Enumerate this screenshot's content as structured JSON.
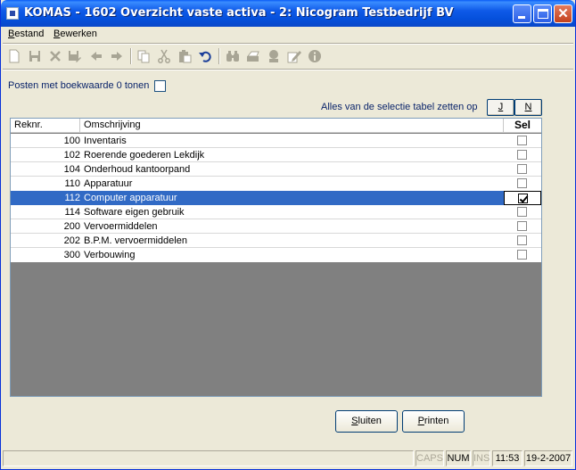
{
  "window": {
    "title": "KOMAS - 1602 Overzicht vaste activa - 2: Nicogram Testbedrijf BV",
    "controls": {
      "close_glyph": "✕"
    }
  },
  "menu": {
    "items": [
      {
        "label_prefix": "B",
        "label_rest": "estand"
      },
      {
        "label_prefix": "",
        "label_underline": "B",
        "label_rest": "ewerken",
        "full": "Bewerken"
      }
    ]
  },
  "toolbar": {
    "icons": [
      "new-icon",
      "save-icon",
      "delete-icon",
      "save-as-icon",
      "back-arrow-icon",
      "forward-arrow-icon",
      "copy-icon",
      "cut-icon",
      "paste-icon",
      "undo-icon",
      "binoculars-icon",
      "print-icon",
      "stamp-icon",
      "edit-icon",
      "info-icon"
    ]
  },
  "filters": {
    "zero_value_label": "Posten met boekwaarde 0 tonen",
    "zero_value_checked": false,
    "select_all_label": "Alles van de selectie tabel zetten op",
    "btn_yes": "J",
    "btn_no": "N"
  },
  "table": {
    "columns": [
      "Reknr.",
      "Omschrijving",
      "Sel"
    ],
    "rows": [
      {
        "num": "100",
        "desc": "Inventaris",
        "sel": false
      },
      {
        "num": "102",
        "desc": "Roerende goederen Lekdijk",
        "sel": false
      },
      {
        "num": "104",
        "desc": "Onderhoud kantoorpand",
        "sel": false
      },
      {
        "num": "110",
        "desc": "Apparatuur",
        "sel": false
      },
      {
        "num": "112",
        "desc": "Computer apparatuur",
        "sel": true
      },
      {
        "num": "114",
        "desc": "Software eigen gebruik",
        "sel": false
      },
      {
        "num": "200",
        "desc": "Vervoermiddelen",
        "sel": false
      },
      {
        "num": "202",
        "desc": "B.P.M. vervoermiddelen",
        "sel": false
      },
      {
        "num": "300",
        "desc": "Verbouwing",
        "sel": false
      }
    ],
    "selected_row": 4
  },
  "buttons": {
    "close": "Sluiten",
    "print": "Printen"
  },
  "status": {
    "caps": "CAPS",
    "num": "NUM",
    "ins": "INS",
    "time": "11:53",
    "date": "19-2-2007"
  }
}
